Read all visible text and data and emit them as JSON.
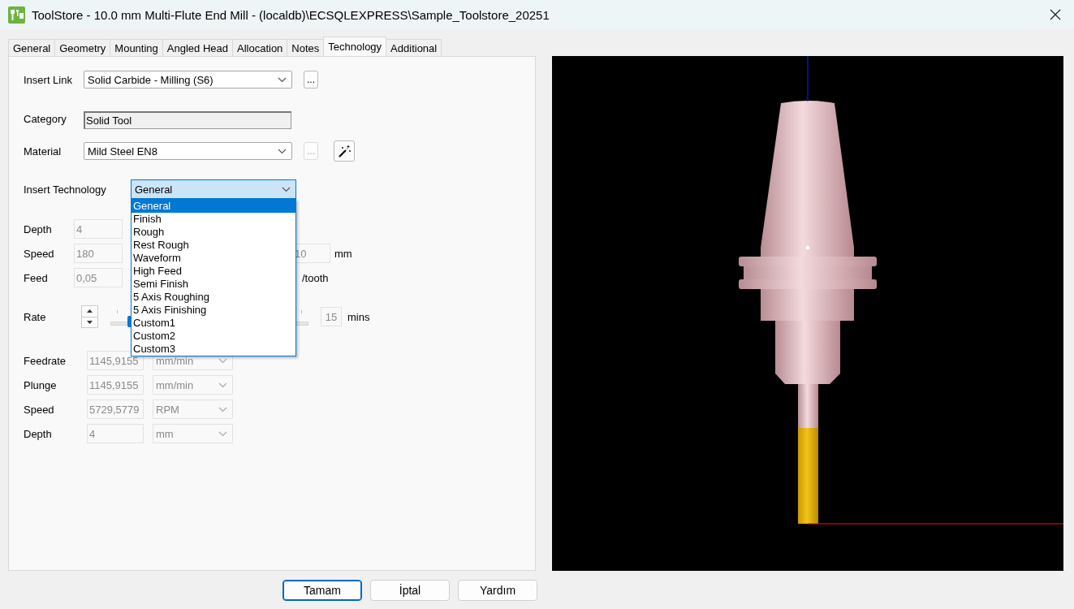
{
  "window": {
    "title": "ToolStore - 10.0 mm Multi-Flute End Mill - (localdb)\\ECSQLEXPRESS\\Sample_Toolstore_20251"
  },
  "tabs": [
    {
      "label": "General",
      "selected": false
    },
    {
      "label": "Geometry",
      "selected": false
    },
    {
      "label": "Mounting",
      "selected": false
    },
    {
      "label": "Angled Head",
      "selected": false
    },
    {
      "label": "Allocation",
      "selected": false
    },
    {
      "label": "Notes",
      "selected": false
    },
    {
      "label": "Technology",
      "selected": true
    },
    {
      "label": "Additional",
      "selected": false
    }
  ],
  "form": {
    "insert_link": {
      "label": "Insert Link",
      "value": "Solid Carbide - Milling (S6)",
      "button": "..."
    },
    "category": {
      "label": "Category",
      "value": "Solid Tool"
    },
    "material": {
      "label": "Material",
      "value": "Mild Steel EN8",
      "button": "...",
      "button_disabled": true
    },
    "insert_technology": {
      "label": "Insert Technology",
      "value": "General",
      "expanded": true,
      "options": [
        {
          "label": "General",
          "selected": true
        },
        {
          "label": "Finish",
          "selected": false
        },
        {
          "label": "Rough",
          "selected": false
        },
        {
          "label": "Rest Rough",
          "selected": false
        },
        {
          "label": "Waveform",
          "selected": false
        },
        {
          "label": "High Feed",
          "selected": false
        },
        {
          "label": "Semi Finish",
          "selected": false
        },
        {
          "label": "5 Axis Roughing",
          "selected": false
        },
        {
          "label": "5 Axis Finishing",
          "selected": false
        },
        {
          "label": "Custom1",
          "selected": false
        },
        {
          "label": "Custom2",
          "selected": false
        },
        {
          "label": "Custom3",
          "selected": false
        }
      ]
    },
    "cutting": [
      {
        "label": "Depth",
        "value": "4"
      },
      {
        "label": "Speed",
        "value": "180",
        "extra_value": "10",
        "extra_unit": "mm"
      },
      {
        "label": "Feed",
        "value": "0,05",
        "extra_unit": "/tooth"
      }
    ],
    "rate": {
      "label": "Rate",
      "level": 0.1,
      "value": "15",
      "unit": "mins"
    },
    "results": [
      {
        "label": "Feedrate",
        "value": "1145,9155",
        "unit": "mm/min"
      },
      {
        "label": "Plunge",
        "value": "1145,9155",
        "unit": "mm/min"
      },
      {
        "label": "Speed",
        "value": "5729,5779",
        "unit": "RPM"
      },
      {
        "label": "Depth",
        "value": "4",
        "unit": "mm"
      }
    ]
  },
  "buttons": [
    {
      "label": "Tamam",
      "default": true
    },
    {
      "label": "İptal",
      "default": false
    },
    {
      "label": "Yardım",
      "default": false
    }
  ]
}
